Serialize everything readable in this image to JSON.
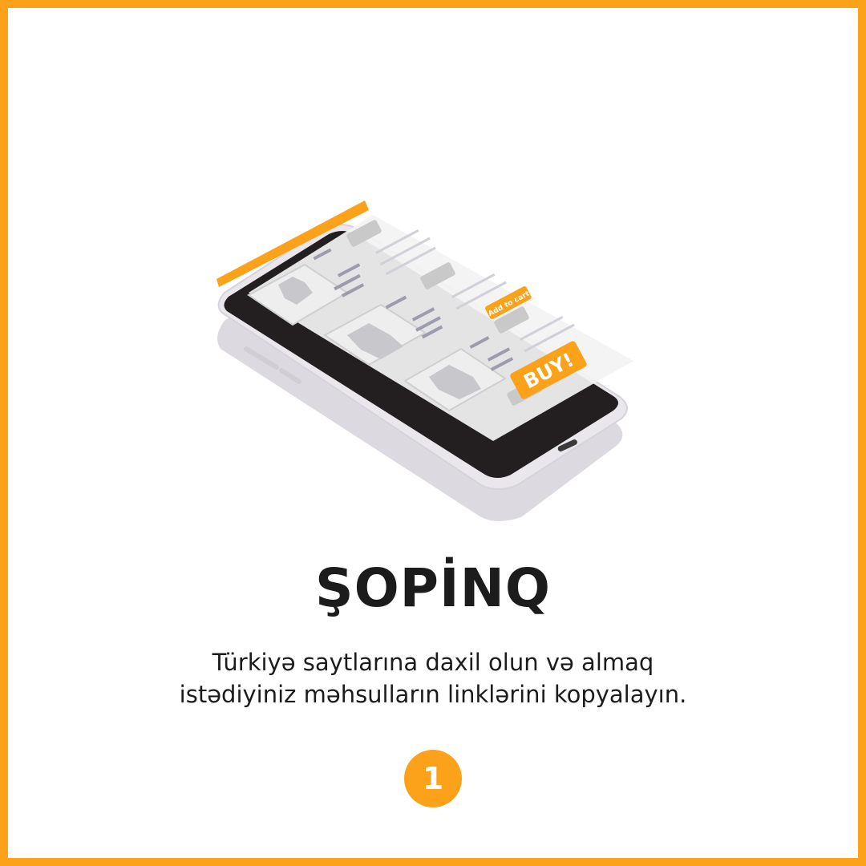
{
  "title": "ŞOPİNQ",
  "description": {
    "line1": "Türkiyə saytlarına daxil olun və almaq",
    "line2": "istədiyiniz məhsulların linklərini kopyalayın."
  },
  "step_number": "1",
  "illustration": {
    "add_to_cart_label": "Add to cart",
    "buy_label": "BUY!"
  },
  "colors": {
    "accent": "#FBA21A",
    "text": "#1c1c1c",
    "background": "#ffffff",
    "phone_body": "#e9e7ec",
    "screen": "#231f20"
  },
  "icons": [
    "tank-top-icon",
    "t-shirt-icon",
    "jacket-icon",
    "smartphone-icon"
  ]
}
